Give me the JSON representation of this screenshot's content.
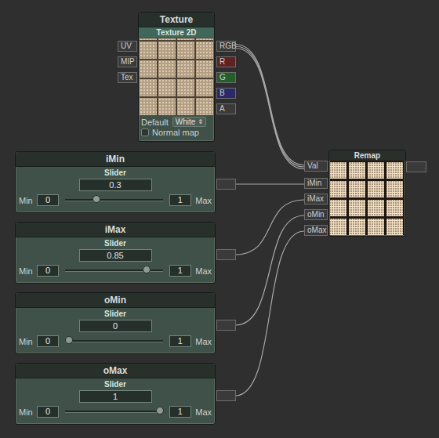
{
  "texture_node": {
    "title": "Texture",
    "subtitle": "Texture 2D",
    "inputs": [
      "UV",
      "MIP",
      "Tex"
    ],
    "outputs": [
      {
        "label": "RGB",
        "color": "#3a3a3a"
      },
      {
        "label": "R",
        "color": "#5e2222"
      },
      {
        "label": "G",
        "color": "#245e2a"
      },
      {
        "label": "B",
        "color": "#2a2a6a"
      },
      {
        "label": "A",
        "color": "#3a3a3a"
      }
    ],
    "default_label": "Default",
    "default_value": "White",
    "dropdown_icon": "⇕",
    "normal_map": {
      "label": "Normal map",
      "checked": false
    }
  },
  "sliders": [
    {
      "title": "iMin",
      "subtitle": "Slider",
      "value": "0.3",
      "min_label": "Min",
      "min": "0",
      "max": "1",
      "max_label": "Max",
      "level": 0.3
    },
    {
      "title": "iMax",
      "subtitle": "Slider",
      "value": "0.85",
      "min_label": "Min",
      "min": "0",
      "max": "1",
      "max_label": "Max",
      "level": 0.85
    },
    {
      "title": "oMin",
      "subtitle": "Slider",
      "value": "0",
      "min_label": "Min",
      "min": "0",
      "max": "1",
      "max_label": "Max",
      "level": 0
    },
    {
      "title": "oMax",
      "subtitle": "Slider",
      "value": "1",
      "min_label": "Min",
      "min": "0",
      "max": "1",
      "max_label": "Max",
      "level": 1
    }
  ],
  "remap_node": {
    "title": "Remap",
    "inputs": [
      "Val",
      "iMin",
      "iMax",
      "oMin",
      "oMax"
    ]
  },
  "connections": [
    {
      "from": "RGB",
      "to": "Val",
      "lines": 3
    },
    {
      "from": "iMin",
      "to": "iMin",
      "lines": 1
    },
    {
      "from": "iMax",
      "to": "iMax",
      "lines": 1
    },
    {
      "from": "oMin",
      "to": "oMin",
      "lines": 1
    },
    {
      "from": "oMax",
      "to": "oMax",
      "lines": 1
    }
  ]
}
